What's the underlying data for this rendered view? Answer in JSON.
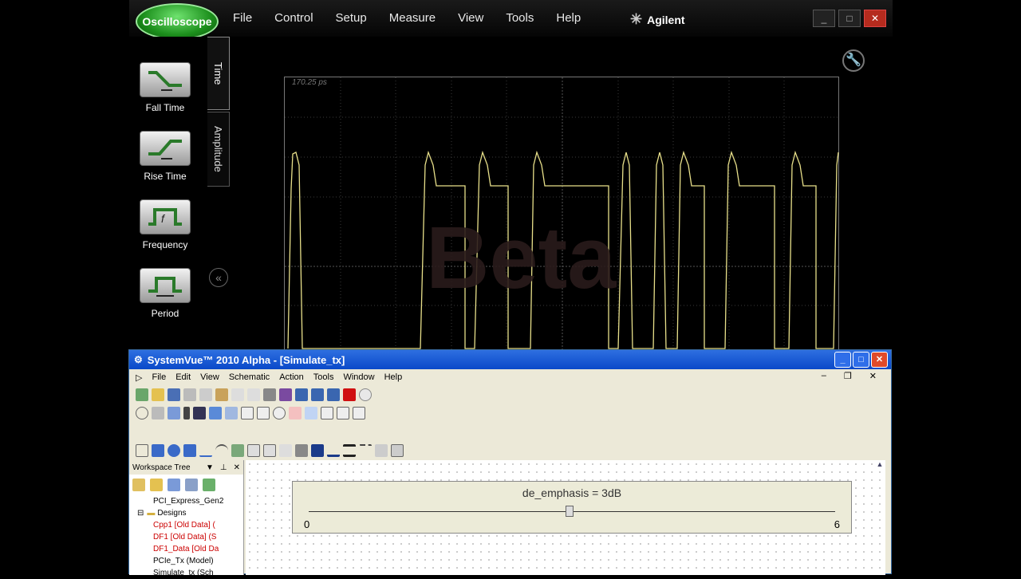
{
  "scope": {
    "logo": "Oscilloscope",
    "menu": [
      "File",
      "Control",
      "Setup",
      "Measure",
      "View",
      "Tools",
      "Help"
    ],
    "brand": "Agilent",
    "measurements": [
      {
        "label": "Fall Time",
        "icon": "fall-time-icon"
      },
      {
        "label": "Rise Time",
        "icon": "rise-time-icon"
      },
      {
        "label": "Frequency",
        "icon": "frequency-icon"
      },
      {
        "label": "Period",
        "icon": "period-icon"
      }
    ],
    "tabs": [
      "Time",
      "Amplitude"
    ],
    "time_label": "170.25 ps",
    "watermark": "Beta",
    "trace_color": "#e8e08a"
  },
  "systemvue": {
    "title": "SystemVue™ 2010 Alpha - [Simulate_tx]",
    "menu": [
      "File",
      "Edit",
      "View",
      "Schematic",
      "Action",
      "Tools",
      "Window",
      "Help"
    ],
    "tree_title": "Workspace Tree",
    "tree": [
      {
        "label": "PCI_Express_Gen2",
        "color": "#000"
      },
      {
        "label": "Designs",
        "color": "#000"
      },
      {
        "label": "Cpp1 [Old Data] (",
        "color": "#c00"
      },
      {
        "label": "DF1 [Old Data] (S",
        "color": "#c00"
      },
      {
        "label": "DF1_Data [Old Da",
        "color": "#c00"
      },
      {
        "label": "PCIe_Tx (Model)",
        "color": "#000"
      },
      {
        "label": "Simulate_tx (Sch",
        "color": "#000"
      }
    ],
    "slider": {
      "label": "de_emphasis  =  3dB",
      "min": "0",
      "max": "6",
      "value": 3
    }
  }
}
